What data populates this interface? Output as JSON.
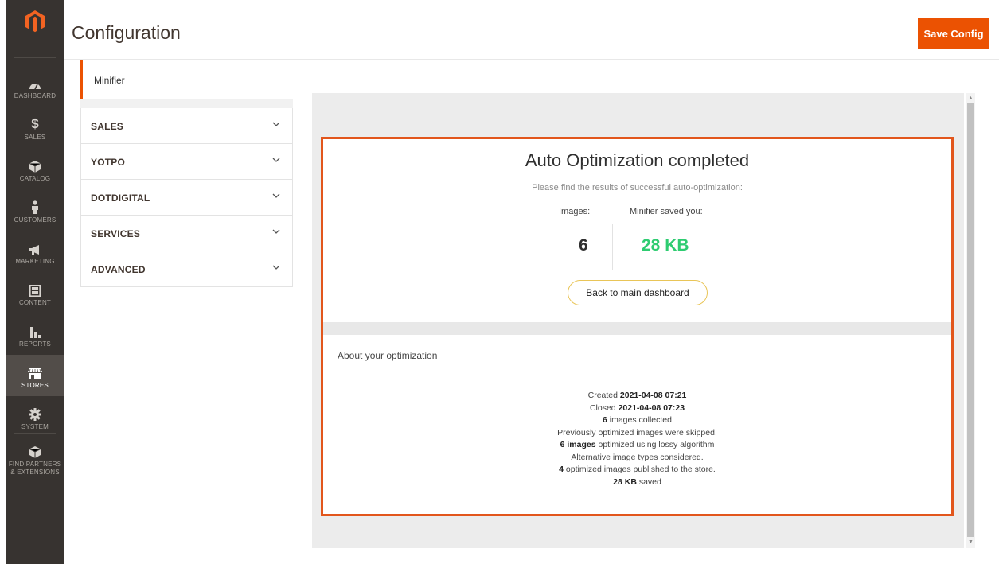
{
  "app": {
    "page_title": "Configuration",
    "save_label": "Save Config"
  },
  "nav": {
    "items": [
      {
        "label": "DASHBOARD",
        "icon": "dashboard-icon"
      },
      {
        "label": "SALES",
        "icon": "dollar-icon"
      },
      {
        "label": "CATALOG",
        "icon": "cube-icon"
      },
      {
        "label": "CUSTOMERS",
        "icon": "person-icon"
      },
      {
        "label": "MARKETING",
        "icon": "megaphone-icon"
      },
      {
        "label": "CONTENT",
        "icon": "content-icon"
      },
      {
        "label": "REPORTS",
        "icon": "bar-chart-icon"
      },
      {
        "label": "STORES",
        "icon": "storefront-icon",
        "active": true
      },
      {
        "label": "SYSTEM",
        "icon": "gear-icon"
      },
      {
        "label1": "FIND PARTNERS",
        "label2": "& EXTENSIONS",
        "icon": "box-icon"
      }
    ]
  },
  "config_tabs": {
    "current": "Minifier",
    "sections": [
      "SALES",
      "YOTPO",
      "DOTDIGITAL",
      "SERVICES",
      "ADVANCED"
    ]
  },
  "result": {
    "title": "Auto Optimization completed",
    "subtitle": "Please find the results of successful auto-optimization:",
    "images_label": "Images:",
    "saved_label": "Minifier saved you:",
    "images_value": "6",
    "saved_value": "28 KB",
    "back_label": "Back to main dashboard"
  },
  "about": {
    "title": "About your optimization",
    "created_label": "Created",
    "created_value": "2021-04-08 07:21",
    "closed_label": "Closed",
    "closed_value": "2021-04-08 07:23",
    "collected_count": "6",
    "collected_text": "images collected",
    "skipped_text": "Previously optimized images were skipped.",
    "optimized_bold": "6 images",
    "optimized_text": "optimized using lossy algorithm",
    "alt_text": "Alternative image types considered.",
    "published_count": "4",
    "published_text": "optimized images published to the store.",
    "saved_bold": "28 KB",
    "saved_text": "saved"
  },
  "colors": {
    "accent": "#eb5202",
    "saved_green": "#2ecc71",
    "nav_bg": "#373330"
  }
}
